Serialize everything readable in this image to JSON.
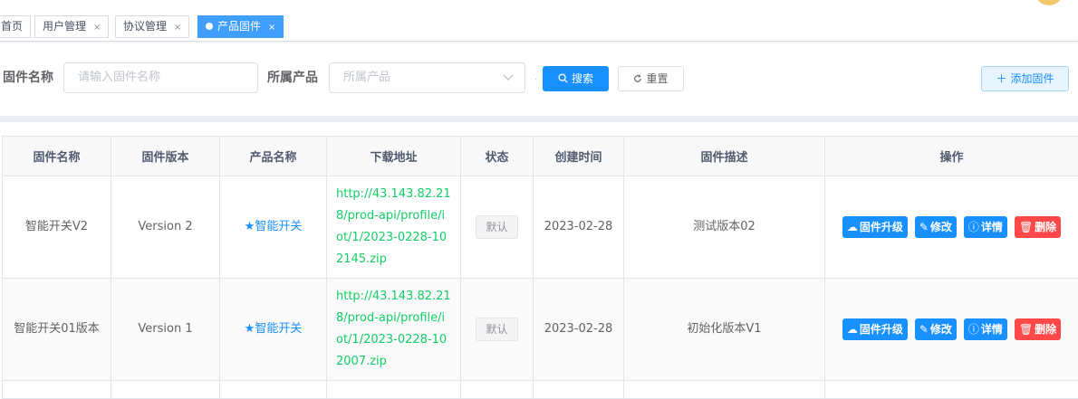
{
  "tags": [
    {
      "label": "首页",
      "closable": false,
      "active": false
    },
    {
      "label": "用户管理",
      "closable": true,
      "active": false
    },
    {
      "label": "协议管理",
      "closable": true,
      "active": false
    },
    {
      "label": "产品固件",
      "closable": true,
      "active": true
    }
  ],
  "tag_close_glyph": "×",
  "search": {
    "firmware_label": "固件名称",
    "firmware_placeholder": "请输入固件名称",
    "product_label": "所属产品",
    "product_placeholder": "所属产品",
    "search_button": "搜索",
    "reset_button": "重置",
    "add_button": "添加固件"
  },
  "table": {
    "columns": [
      "固件名称",
      "固件版本",
      "产品名称",
      "下载地址",
      "状态",
      "创建时间",
      "固件描述",
      "操作"
    ],
    "rows": [
      {
        "name": "智能开关V2",
        "version": "Version 2",
        "product": "★智能开关",
        "url": "http://43.143.82.218/prod-api/profile/iot/1/2023-0228-102145.zip",
        "status": "默认",
        "created": "2023-02-28",
        "description": "测试版本02"
      },
      {
        "name": "智能开关01版本",
        "version": "Version 1",
        "product": "★智能开关",
        "url": "http://43.143.82.218/prod-api/profile/iot/1/2023-0228-102007.zip",
        "status": "默认",
        "created": "2023-02-28",
        "description": "初始化版本V1"
      }
    ],
    "actions": {
      "upgrade": "固件升级",
      "edit": "修改",
      "detail": "详情",
      "delete": "删除"
    }
  },
  "colors": {
    "primary": "#1890ff",
    "danger": "#ff4949",
    "success_link": "#13ce66",
    "avatar": "#f3c66e"
  },
  "icons": {
    "search": "search-icon",
    "reset": "refresh-icon",
    "add": "plus-icon",
    "upgrade": "cloud-upload-icon",
    "edit": "edit-icon",
    "detail": "info-icon",
    "delete": "trash-icon",
    "select": "chevron-down-icon"
  }
}
